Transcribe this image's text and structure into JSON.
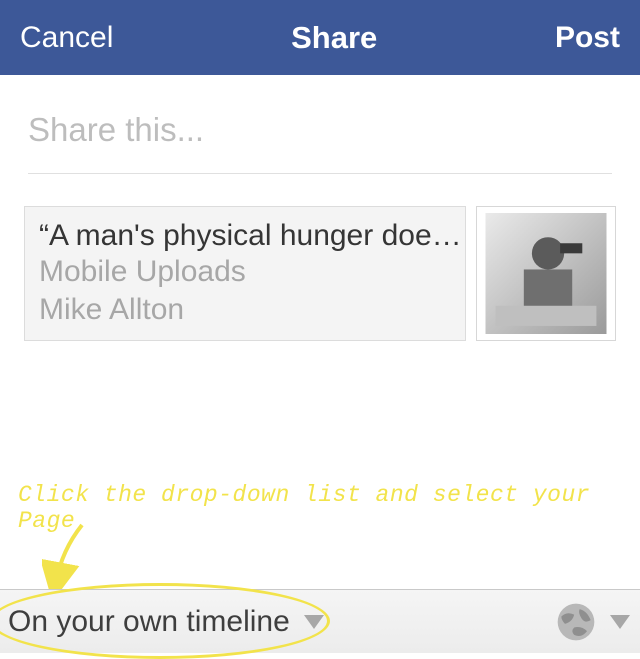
{
  "header": {
    "cancel": "Cancel",
    "title": "Share",
    "post": "Post"
  },
  "compose": {
    "placeholder": "Share this..."
  },
  "attachment": {
    "title": "“A man's physical hunger doe…",
    "subtitle": "Mobile Uploads",
    "author": "Mike Allton"
  },
  "annotation": {
    "text": "Click the drop-down list and select your Page"
  },
  "audience": {
    "label": "On your own timeline"
  }
}
